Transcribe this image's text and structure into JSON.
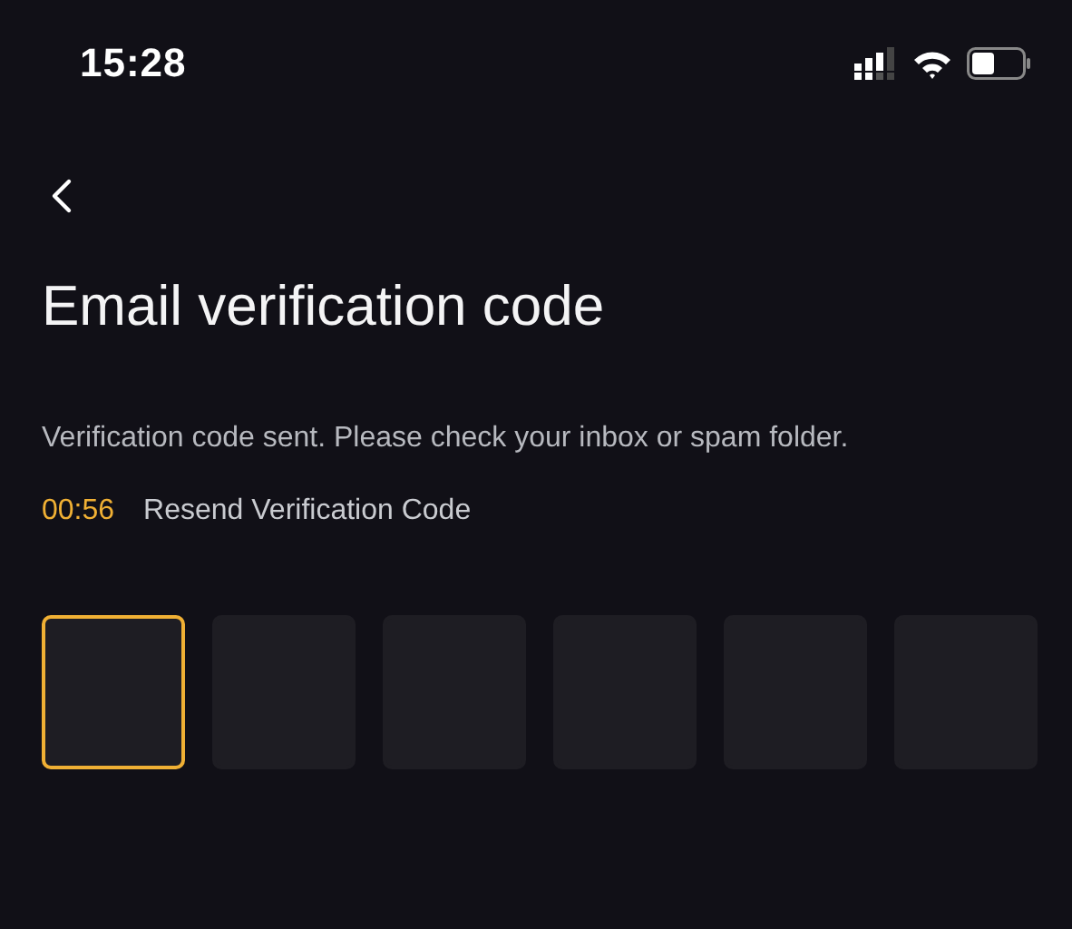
{
  "status_bar": {
    "time": "15:28"
  },
  "title": "Email verification code",
  "message": "Verification code sent. Please check your inbox or spam folder.",
  "countdown": "00:56",
  "resend_link": "Resend Verification Code",
  "code_boxes": [
    {
      "selected": true
    },
    {
      "selected": false
    },
    {
      "selected": false
    },
    {
      "selected": false
    },
    {
      "selected": false
    },
    {
      "selected": false
    }
  ]
}
